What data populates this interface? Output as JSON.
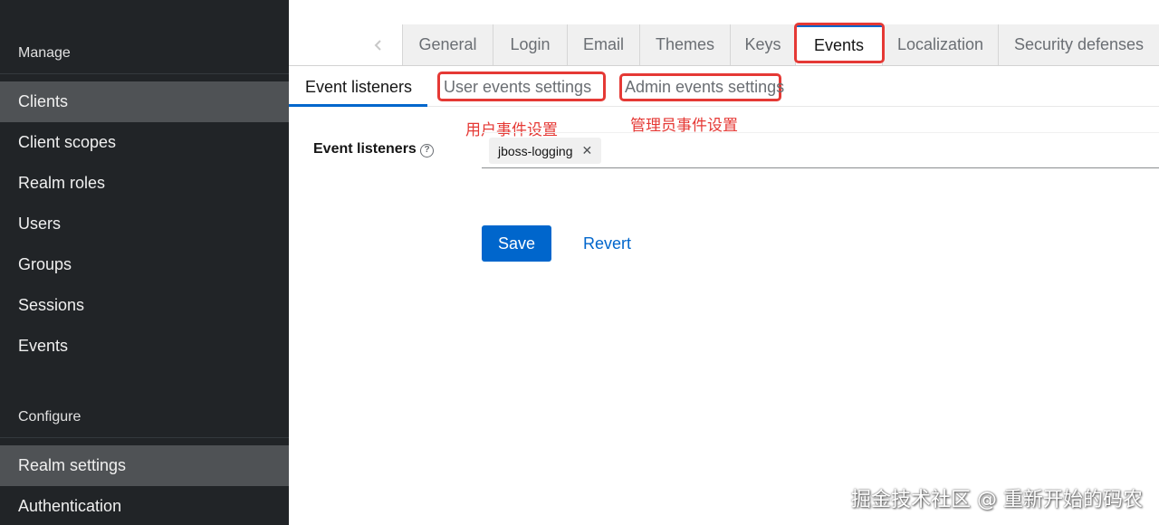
{
  "sidebar": {
    "manage_title": "Manage",
    "manage_items": [
      "Clients",
      "Client scopes",
      "Realm roles",
      "Users",
      "Groups",
      "Sessions",
      "Events"
    ],
    "configure_title": "Configure",
    "configure_items": [
      "Realm settings",
      "Authentication"
    ]
  },
  "tabs": {
    "scroll_left_icon": "chevron-left-icon",
    "items": [
      "General",
      "Login",
      "Email",
      "Themes",
      "Keys",
      "Events",
      "Localization",
      "Security defenses"
    ],
    "active": "Events"
  },
  "subtabs": {
    "items": [
      "Event listeners",
      "User events settings",
      "Admin events settings"
    ],
    "active": "Event listeners"
  },
  "annotations": {
    "user_events": "用户事件设置",
    "admin_events": "管理员事件设置",
    "color": "#e53935"
  },
  "form": {
    "label": "Event listeners",
    "help_icon": "question-circle-icon",
    "help_glyph": "?",
    "chips": [
      "jboss-logging"
    ],
    "chip_remove_glyph": "✕"
  },
  "actions": {
    "save": "Save",
    "revert": "Revert"
  },
  "watermark": "掘金技术社区 @ 重新开始的码农",
  "colors": {
    "sidebar_bg": "#212427",
    "sidebar_active": "#4f5255",
    "primary": "#0066cc"
  }
}
